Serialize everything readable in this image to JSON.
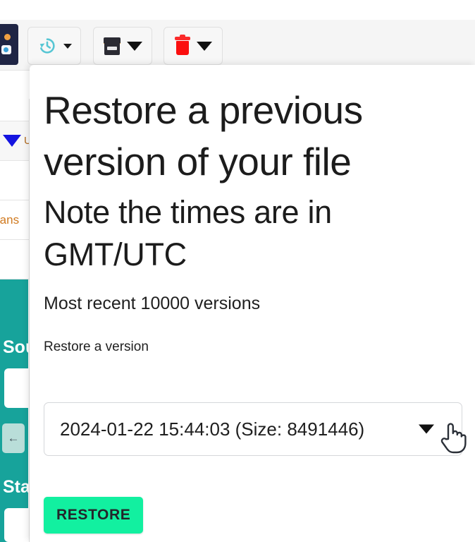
{
  "toolbar": {
    "buttons": [
      {
        "name": "history-restore",
        "icon": "history-clock-icon",
        "has_caret": true
      },
      {
        "name": "archive",
        "icon": "archive-box-icon",
        "has_caret": true
      },
      {
        "name": "delete",
        "icon": "trash-icon",
        "has_caret": true
      }
    ]
  },
  "background": {
    "app_logo": "app-logo",
    "filter_label": "U",
    "row_text": "rans",
    "sidebar": {
      "source_label": "Sou",
      "status_label": "Sta",
      "back_button": "←"
    }
  },
  "popover": {
    "title": "Restore a previous version of your file",
    "subtitle": "Note the times are in GMT/UTC",
    "note": "Most recent 10000 versions",
    "field_label": "Restore a version",
    "select": {
      "value": "2024-01-22 15:44:03 (Size: 8491446)",
      "caret_icon": "chevron-down-icon"
    },
    "restore_button": "RESTORE"
  },
  "colors": {
    "accent_green": "#12f0a0",
    "sidebar_teal": "#17a39b",
    "danger_red": "#fb0f0f",
    "filter_blue": "#1414e0"
  }
}
